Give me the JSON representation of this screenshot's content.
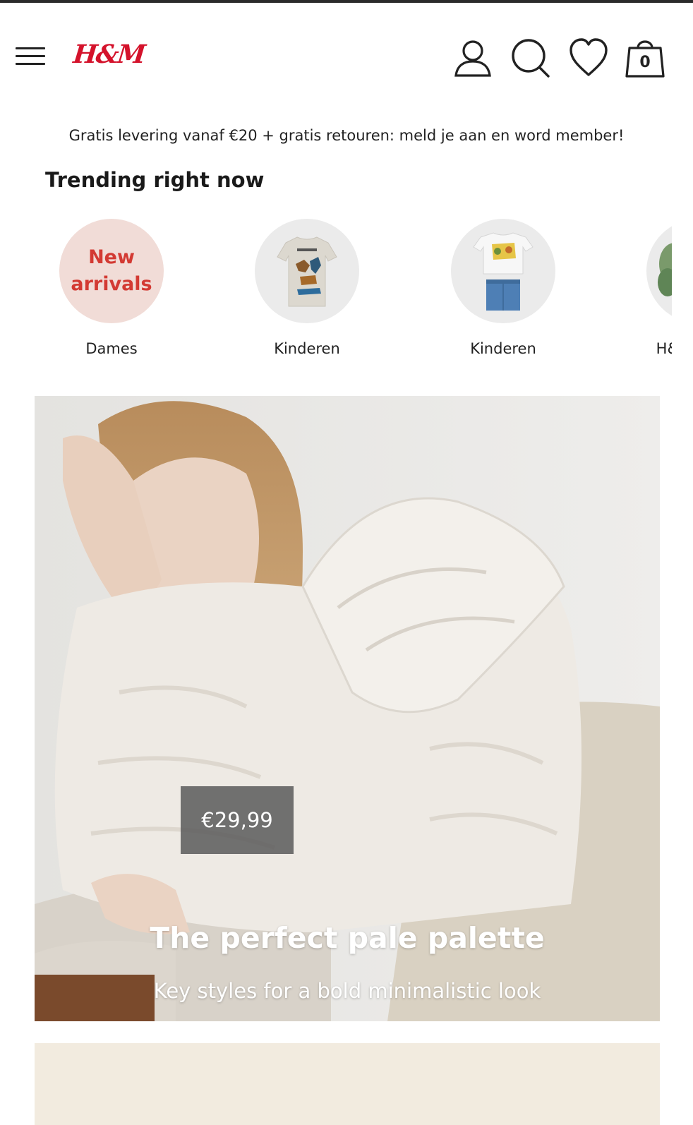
{
  "header": {
    "logo": "H&M",
    "menu_icon": "hamburger-menu-icon",
    "account_icon": "user-icon",
    "search_icon": "search-icon",
    "favorites_icon": "heart-icon",
    "bag_icon": "shopping-bag-icon",
    "bag_count": "0"
  },
  "promo": {
    "text": "Gratis levering vanaf €20 + gratis retouren: meld je aan en word member!"
  },
  "trending": {
    "title": "Trending right now",
    "items": [
      {
        "badge": "New\narrivals",
        "label": "Dames"
      },
      {
        "label": "Kinderen"
      },
      {
        "label": "Kinderen"
      },
      {
        "label": "H&M HOME"
      }
    ]
  },
  "hero": {
    "price": "€29,99",
    "title": "The perfect pale palette",
    "subtitle": "Key styles for a bold minimalistic look"
  },
  "colors": {
    "brand_red": "#d4122b",
    "new_arrivals_bg": "#f1dcd7",
    "next_banner_bg": "#f2ebdf"
  }
}
